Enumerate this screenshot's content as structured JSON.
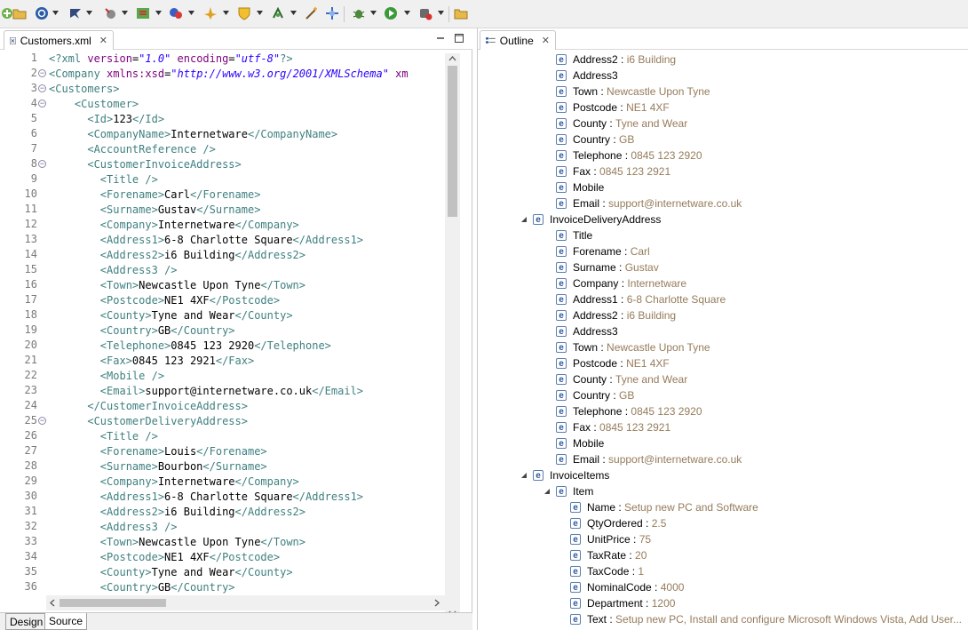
{
  "toolbar": {
    "icons": [
      "new-wizard-icon",
      "open-folder-icon",
      "globe-icon",
      "run-config-icon",
      "hammer-icon",
      "mapping-icon",
      "color-palette-icon",
      "transform-icon",
      "shield-icon",
      "schema-icon",
      "magic-wand-icon",
      "debug-target-icon",
      "bug-icon",
      "run-icon",
      "record-icon",
      "open-file-icon"
    ]
  },
  "editor": {
    "tab_label": "Customers.xml",
    "bottom_tabs": [
      "Design",
      "Source"
    ],
    "lines": [
      {
        "n": "1",
        "fold": false,
        "html": "<span class=\"tg\">&lt;?xml </span><span class=\"at\">version</span>=<span class=\"av\">\"1.0\"</span> <span class=\"at\">encoding</span>=<span class=\"av\">\"utf-8\"</span><span class=\"tg\">?&gt;</span>"
      },
      {
        "n": "2",
        "fold": true,
        "html": "<span class=\"tg\">&lt;Company </span><span class=\"at\">xmlns:xsd</span>=<span class=\"av\">\"http://www.w3.org/2001/XMLSchema\"</span> <span class=\"at\">xm</span>"
      },
      {
        "n": "3",
        "fold": true,
        "html": "<span class=\"tg\">&lt;Customers&gt;</span>"
      },
      {
        "n": "4",
        "fold": true,
        "html": "    <span class=\"tg\">&lt;Customer&gt;</span>"
      },
      {
        "n": "5",
        "fold": false,
        "html": "      <span class=\"tg\">&lt;Id&gt;</span>123<span class=\"tg\">&lt;/Id&gt;</span>"
      },
      {
        "n": "6",
        "fold": false,
        "html": "      <span class=\"tg\">&lt;CompanyName&gt;</span>Internetware<span class=\"tg\">&lt;/CompanyName&gt;</span>"
      },
      {
        "n": "7",
        "fold": false,
        "html": "      <span class=\"tg\">&lt;AccountReference /&gt;</span>"
      },
      {
        "n": "8",
        "fold": true,
        "html": "      <span class=\"tg\">&lt;CustomerInvoiceAddress&gt;</span>"
      },
      {
        "n": "9",
        "fold": false,
        "html": "        <span class=\"tg\">&lt;Title /&gt;</span>"
      },
      {
        "n": "10",
        "fold": false,
        "html": "        <span class=\"tg\">&lt;Forename&gt;</span>Carl<span class=\"tg\">&lt;/Forename&gt;</span>"
      },
      {
        "n": "11",
        "fold": false,
        "html": "        <span class=\"tg\">&lt;Surname&gt;</span>Gustav<span class=\"tg\">&lt;/Surname&gt;</span>"
      },
      {
        "n": "12",
        "fold": false,
        "html": "        <span class=\"tg\">&lt;Company&gt;</span>Internetware<span class=\"tg\">&lt;/Company&gt;</span>"
      },
      {
        "n": "13",
        "fold": false,
        "html": "        <span class=\"tg\">&lt;Address1&gt;</span>6-8 Charlotte Square<span class=\"tg\">&lt;/Address1&gt;</span>"
      },
      {
        "n": "14",
        "fold": false,
        "html": "        <span class=\"tg\">&lt;Address2&gt;</span>i6 Building<span class=\"tg\">&lt;/Address2&gt;</span>"
      },
      {
        "n": "15",
        "fold": false,
        "html": "        <span class=\"tg\">&lt;Address3 /&gt;</span>"
      },
      {
        "n": "16",
        "fold": false,
        "html": "        <span class=\"tg\">&lt;Town&gt;</span>Newcastle Upon Tyne<span class=\"tg\">&lt;/Town&gt;</span>"
      },
      {
        "n": "17",
        "fold": false,
        "html": "        <span class=\"tg\">&lt;Postcode&gt;</span>NE1 4XF<span class=\"tg\">&lt;/Postcode&gt;</span>"
      },
      {
        "n": "18",
        "fold": false,
        "html": "        <span class=\"tg\">&lt;County&gt;</span>Tyne and Wear<span class=\"tg\">&lt;/County&gt;</span>"
      },
      {
        "n": "19",
        "fold": false,
        "html": "        <span class=\"tg\">&lt;Country&gt;</span>GB<span class=\"tg\">&lt;/Country&gt;</span>"
      },
      {
        "n": "20",
        "fold": false,
        "html": "        <span class=\"tg\">&lt;Telephone&gt;</span>0845 123 2920<span class=\"tg\">&lt;/Telephone&gt;</span>"
      },
      {
        "n": "21",
        "fold": false,
        "html": "        <span class=\"tg\">&lt;Fax&gt;</span>0845 123 2921<span class=\"tg\">&lt;/Fax&gt;</span>"
      },
      {
        "n": "22",
        "fold": false,
        "html": "        <span class=\"tg\">&lt;Mobile /&gt;</span>"
      },
      {
        "n": "23",
        "fold": false,
        "html": "        <span class=\"tg\">&lt;Email&gt;</span>support@internetware.co.uk<span class=\"tg\">&lt;/Email&gt;</span>"
      },
      {
        "n": "24",
        "fold": false,
        "html": "      <span class=\"tg\">&lt;/CustomerInvoiceAddress&gt;</span>"
      },
      {
        "n": "25",
        "fold": true,
        "html": "      <span class=\"tg\">&lt;CustomerDeliveryAddress&gt;</span>"
      },
      {
        "n": "26",
        "fold": false,
        "html": "        <span class=\"tg\">&lt;Title /&gt;</span>"
      },
      {
        "n": "27",
        "fold": false,
        "html": "        <span class=\"tg\">&lt;Forename&gt;</span>Louis<span class=\"tg\">&lt;/Forename&gt;</span>"
      },
      {
        "n": "28",
        "fold": false,
        "html": "        <span class=\"tg\">&lt;Surname&gt;</span>Bourbon<span class=\"tg\">&lt;/Surname&gt;</span>"
      },
      {
        "n": "29",
        "fold": false,
        "html": "        <span class=\"tg\">&lt;Company&gt;</span>Internetware<span class=\"tg\">&lt;/Company&gt;</span>"
      },
      {
        "n": "30",
        "fold": false,
        "html": "        <span class=\"tg\">&lt;Address1&gt;</span>6-8 Charlotte Square<span class=\"tg\">&lt;/Address1&gt;</span>"
      },
      {
        "n": "31",
        "fold": false,
        "html": "        <span class=\"tg\">&lt;Address2&gt;</span>i6 Building<span class=\"tg\">&lt;/Address2&gt;</span>"
      },
      {
        "n": "32",
        "fold": false,
        "html": "        <span class=\"tg\">&lt;Address3 /&gt;</span>"
      },
      {
        "n": "33",
        "fold": false,
        "html": "        <span class=\"tg\">&lt;Town&gt;</span>Newcastle Upon Tyne<span class=\"tg\">&lt;/Town&gt;</span>"
      },
      {
        "n": "34",
        "fold": false,
        "html": "        <span class=\"tg\">&lt;Postcode&gt;</span>NE1 4XF<span class=\"tg\">&lt;/Postcode&gt;</span>"
      },
      {
        "n": "35",
        "fold": false,
        "html": "        <span class=\"tg\">&lt;County&gt;</span>Tyne and Wear<span class=\"tg\">&lt;/County&gt;</span>"
      },
      {
        "n": "36",
        "fold": false,
        "html": "        <span class=\"tg\">&lt;Country&gt;</span>GB<span class=\"tg\">&lt;/Country&gt;</span>"
      }
    ]
  },
  "outline": {
    "tab_label": "Outline",
    "rows": [
      {
        "level": 2,
        "expander": "",
        "name": "Address2",
        "value": "i6 Building"
      },
      {
        "level": 2,
        "expander": "",
        "name": "Address3",
        "value": ""
      },
      {
        "level": 2,
        "expander": "",
        "name": "Town",
        "value": "Newcastle Upon Tyne"
      },
      {
        "level": 2,
        "expander": "",
        "name": "Postcode",
        "value": "NE1 4XF"
      },
      {
        "level": 2,
        "expander": "",
        "name": "County",
        "value": "Tyne and Wear"
      },
      {
        "level": 2,
        "expander": "",
        "name": "Country",
        "value": "GB"
      },
      {
        "level": 2,
        "expander": "",
        "name": "Telephone",
        "value": "0845 123 2920"
      },
      {
        "level": 2,
        "expander": "",
        "name": "Fax",
        "value": "0845 123 2921"
      },
      {
        "level": 2,
        "expander": "",
        "name": "Mobile",
        "value": ""
      },
      {
        "level": 2,
        "expander": "",
        "name": "Email",
        "value": "support@internetware.co.uk"
      },
      {
        "level": 1,
        "expander": "expanded",
        "name": "InvoiceDeliveryAddress",
        "value": ""
      },
      {
        "level": 2,
        "expander": "",
        "name": "Title",
        "value": ""
      },
      {
        "level": 2,
        "expander": "",
        "name": "Forename",
        "value": "Carl"
      },
      {
        "level": 2,
        "expander": "",
        "name": "Surname",
        "value": "Gustav"
      },
      {
        "level": 2,
        "expander": "",
        "name": "Company",
        "value": "Internetware"
      },
      {
        "level": 2,
        "expander": "",
        "name": "Address1",
        "value": "6-8 Charlotte Square"
      },
      {
        "level": 2,
        "expander": "",
        "name": "Address2",
        "value": "i6 Building"
      },
      {
        "level": 2,
        "expander": "",
        "name": "Address3",
        "value": ""
      },
      {
        "level": 2,
        "expander": "",
        "name": "Town",
        "value": "Newcastle Upon Tyne"
      },
      {
        "level": 2,
        "expander": "",
        "name": "Postcode",
        "value": "NE1 4XF"
      },
      {
        "level": 2,
        "expander": "",
        "name": "County",
        "value": "Tyne and Wear"
      },
      {
        "level": 2,
        "expander": "",
        "name": "Country",
        "value": "GB"
      },
      {
        "level": 2,
        "expander": "",
        "name": "Telephone",
        "value": "0845 123 2920"
      },
      {
        "level": 2,
        "expander": "",
        "name": "Fax",
        "value": "0845 123 2921"
      },
      {
        "level": 2,
        "expander": "",
        "name": "Mobile",
        "value": ""
      },
      {
        "level": 2,
        "expander": "",
        "name": "Email",
        "value": "support@internetware.co.uk"
      },
      {
        "level": 1,
        "expander": "expanded",
        "name": "InvoiceItems",
        "value": ""
      },
      {
        "level": 2,
        "expander": "expanded",
        "name": "Item",
        "value": ""
      },
      {
        "level": 3,
        "expander": "",
        "name": "Name",
        "value": "Setup new PC and Software"
      },
      {
        "level": 3,
        "expander": "",
        "name": "QtyOrdered",
        "value": "2.5"
      },
      {
        "level": 3,
        "expander": "",
        "name": "UnitPrice",
        "value": "75"
      },
      {
        "level": 3,
        "expander": "",
        "name": "TaxRate",
        "value": "20"
      },
      {
        "level": 3,
        "expander": "",
        "name": "TaxCode",
        "value": "1"
      },
      {
        "level": 3,
        "expander": "",
        "name": "NominalCode",
        "value": "4000"
      },
      {
        "level": 3,
        "expander": "",
        "name": "Department",
        "value": "1200"
      },
      {
        "level": 3,
        "expander": "",
        "name": "Text",
        "value": "Setup new PC, Install and configure Microsoft Windows Vista, Add User..."
      }
    ]
  }
}
